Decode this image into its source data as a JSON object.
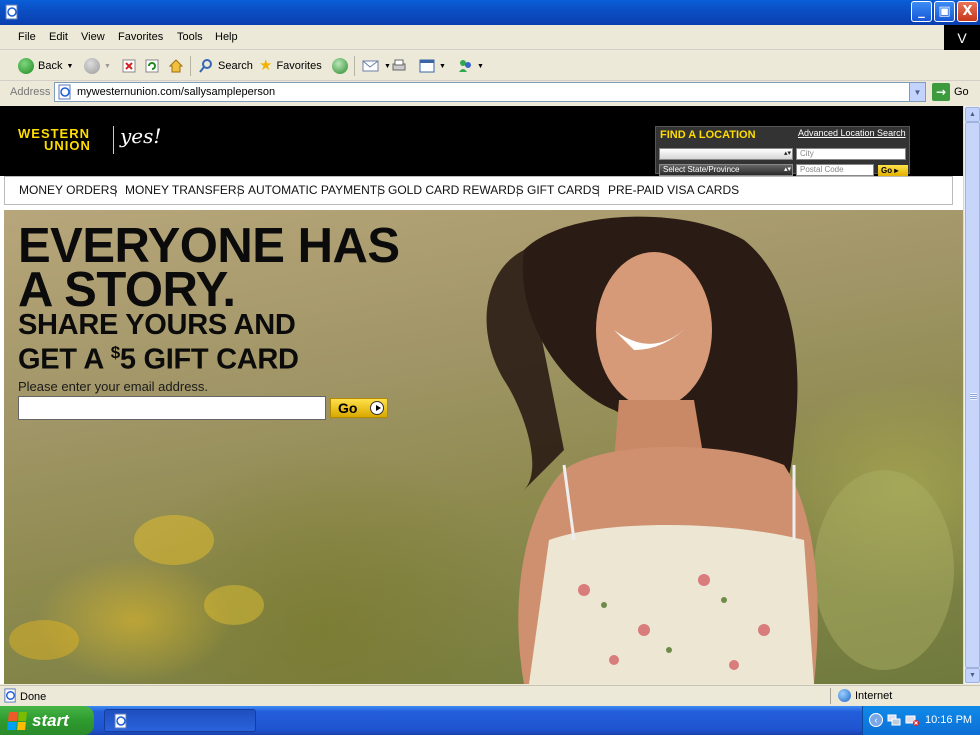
{
  "window": {
    "close_glyph": "X",
    "maximize_glyph": "▣",
    "minimize_glyph": "_"
  },
  "menubar": {
    "items": [
      "File",
      "Edit",
      "View",
      "Favorites",
      "Tools",
      "Help"
    ],
    "brand": "V"
  },
  "toolbar": {
    "back_label": "Back",
    "search_label": "Search",
    "favorites_label": "Favorites"
  },
  "address": {
    "label": "Address",
    "url": "mywesternunion.com/sallysampleperson",
    "go_label": "Go"
  },
  "wu": {
    "logo_line1": "WESTERN",
    "logo_line2": "UNION",
    "tagline": "yes!",
    "find_location": {
      "title": "FIND A LOCATION",
      "advanced_link": "Advanced Location Search",
      "city_placeholder": "City",
      "state_select": "Select State/Province",
      "postal_placeholder": "Postal Code",
      "go_label": "Go"
    },
    "nav": [
      "MONEY ORDERS",
      "MONEY TRANSFERS",
      "AUTOMATIC PAYMENTS",
      "GOLD CARD REWARDS",
      "GIFT CARDS",
      "PRE-PAID VISA CARDS"
    ],
    "nav_separator": "|"
  },
  "hero": {
    "headline_line1": "EVERYONE HAS",
    "headline_line2": "A STORY.",
    "sub_line1": "SHARE YOURS AND",
    "sub_line2_prefix": "GET A ",
    "sub_line2_currency": "$",
    "sub_line2_rest": "5 GIFT CARD",
    "email_label": "Please enter your email address.",
    "email_value": "",
    "go_label": "Go"
  },
  "status": {
    "text": "Done",
    "zone": "Internet"
  },
  "taskbar": {
    "start_label": "start",
    "clock": "10:16 PM"
  },
  "colors": {
    "wu_yellow": "#ffdd00",
    "header_black": "#000000",
    "xp_blue": "#0a5fd8"
  },
  "icons": [
    "ie-page-icon",
    "back-icon",
    "forward-icon",
    "stop-icon",
    "refresh-icon",
    "home-icon",
    "search-icon",
    "favorites-star-icon",
    "history-icon",
    "mail-icon",
    "print-icon",
    "edit-icon",
    "messenger-icon",
    "go-arrow-icon",
    "globe-icon",
    "windows-flag-icon"
  ]
}
